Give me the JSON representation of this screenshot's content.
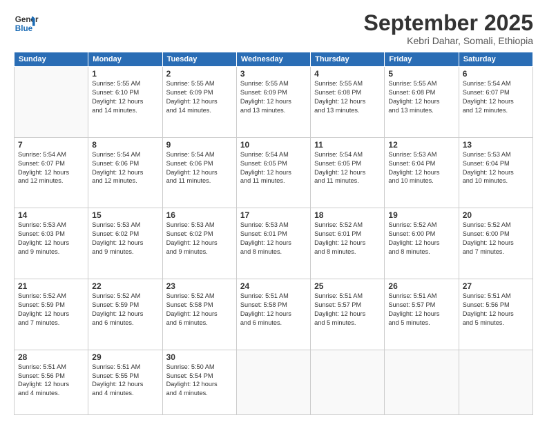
{
  "logo": {
    "line1": "General",
    "line2": "Blue"
  },
  "title": "September 2025",
  "subtitle": "Kebri Dahar, Somali, Ethiopia",
  "days_of_week": [
    "Sunday",
    "Monday",
    "Tuesday",
    "Wednesday",
    "Thursday",
    "Friday",
    "Saturday"
  ],
  "weeks": [
    [
      {
        "day": "",
        "info": ""
      },
      {
        "day": "1",
        "info": "Sunrise: 5:55 AM\nSunset: 6:10 PM\nDaylight: 12 hours\nand 14 minutes."
      },
      {
        "day": "2",
        "info": "Sunrise: 5:55 AM\nSunset: 6:09 PM\nDaylight: 12 hours\nand 14 minutes."
      },
      {
        "day": "3",
        "info": "Sunrise: 5:55 AM\nSunset: 6:09 PM\nDaylight: 12 hours\nand 13 minutes."
      },
      {
        "day": "4",
        "info": "Sunrise: 5:55 AM\nSunset: 6:08 PM\nDaylight: 12 hours\nand 13 minutes."
      },
      {
        "day": "5",
        "info": "Sunrise: 5:55 AM\nSunset: 6:08 PM\nDaylight: 12 hours\nand 13 minutes."
      },
      {
        "day": "6",
        "info": "Sunrise: 5:54 AM\nSunset: 6:07 PM\nDaylight: 12 hours\nand 12 minutes."
      }
    ],
    [
      {
        "day": "7",
        "info": "Sunrise: 5:54 AM\nSunset: 6:07 PM\nDaylight: 12 hours\nand 12 minutes."
      },
      {
        "day": "8",
        "info": "Sunrise: 5:54 AM\nSunset: 6:06 PM\nDaylight: 12 hours\nand 12 minutes."
      },
      {
        "day": "9",
        "info": "Sunrise: 5:54 AM\nSunset: 6:06 PM\nDaylight: 12 hours\nand 11 minutes."
      },
      {
        "day": "10",
        "info": "Sunrise: 5:54 AM\nSunset: 6:05 PM\nDaylight: 12 hours\nand 11 minutes."
      },
      {
        "day": "11",
        "info": "Sunrise: 5:54 AM\nSunset: 6:05 PM\nDaylight: 12 hours\nand 11 minutes."
      },
      {
        "day": "12",
        "info": "Sunrise: 5:53 AM\nSunset: 6:04 PM\nDaylight: 12 hours\nand 10 minutes."
      },
      {
        "day": "13",
        "info": "Sunrise: 5:53 AM\nSunset: 6:04 PM\nDaylight: 12 hours\nand 10 minutes."
      }
    ],
    [
      {
        "day": "14",
        "info": "Sunrise: 5:53 AM\nSunset: 6:03 PM\nDaylight: 12 hours\nand 9 minutes."
      },
      {
        "day": "15",
        "info": "Sunrise: 5:53 AM\nSunset: 6:02 PM\nDaylight: 12 hours\nand 9 minutes."
      },
      {
        "day": "16",
        "info": "Sunrise: 5:53 AM\nSunset: 6:02 PM\nDaylight: 12 hours\nand 9 minutes."
      },
      {
        "day": "17",
        "info": "Sunrise: 5:53 AM\nSunset: 6:01 PM\nDaylight: 12 hours\nand 8 minutes."
      },
      {
        "day": "18",
        "info": "Sunrise: 5:52 AM\nSunset: 6:01 PM\nDaylight: 12 hours\nand 8 minutes."
      },
      {
        "day": "19",
        "info": "Sunrise: 5:52 AM\nSunset: 6:00 PM\nDaylight: 12 hours\nand 8 minutes."
      },
      {
        "day": "20",
        "info": "Sunrise: 5:52 AM\nSunset: 6:00 PM\nDaylight: 12 hours\nand 7 minutes."
      }
    ],
    [
      {
        "day": "21",
        "info": "Sunrise: 5:52 AM\nSunset: 5:59 PM\nDaylight: 12 hours\nand 7 minutes."
      },
      {
        "day": "22",
        "info": "Sunrise: 5:52 AM\nSunset: 5:59 PM\nDaylight: 12 hours\nand 6 minutes."
      },
      {
        "day": "23",
        "info": "Sunrise: 5:52 AM\nSunset: 5:58 PM\nDaylight: 12 hours\nand 6 minutes."
      },
      {
        "day": "24",
        "info": "Sunrise: 5:51 AM\nSunset: 5:58 PM\nDaylight: 12 hours\nand 6 minutes."
      },
      {
        "day": "25",
        "info": "Sunrise: 5:51 AM\nSunset: 5:57 PM\nDaylight: 12 hours\nand 5 minutes."
      },
      {
        "day": "26",
        "info": "Sunrise: 5:51 AM\nSunset: 5:57 PM\nDaylight: 12 hours\nand 5 minutes."
      },
      {
        "day": "27",
        "info": "Sunrise: 5:51 AM\nSunset: 5:56 PM\nDaylight: 12 hours\nand 5 minutes."
      }
    ],
    [
      {
        "day": "28",
        "info": "Sunrise: 5:51 AM\nSunset: 5:56 PM\nDaylight: 12 hours\nand 4 minutes."
      },
      {
        "day": "29",
        "info": "Sunrise: 5:51 AM\nSunset: 5:55 PM\nDaylight: 12 hours\nand 4 minutes."
      },
      {
        "day": "30",
        "info": "Sunrise: 5:50 AM\nSunset: 5:54 PM\nDaylight: 12 hours\nand 4 minutes."
      },
      {
        "day": "",
        "info": ""
      },
      {
        "day": "",
        "info": ""
      },
      {
        "day": "",
        "info": ""
      },
      {
        "day": "",
        "info": ""
      }
    ]
  ]
}
